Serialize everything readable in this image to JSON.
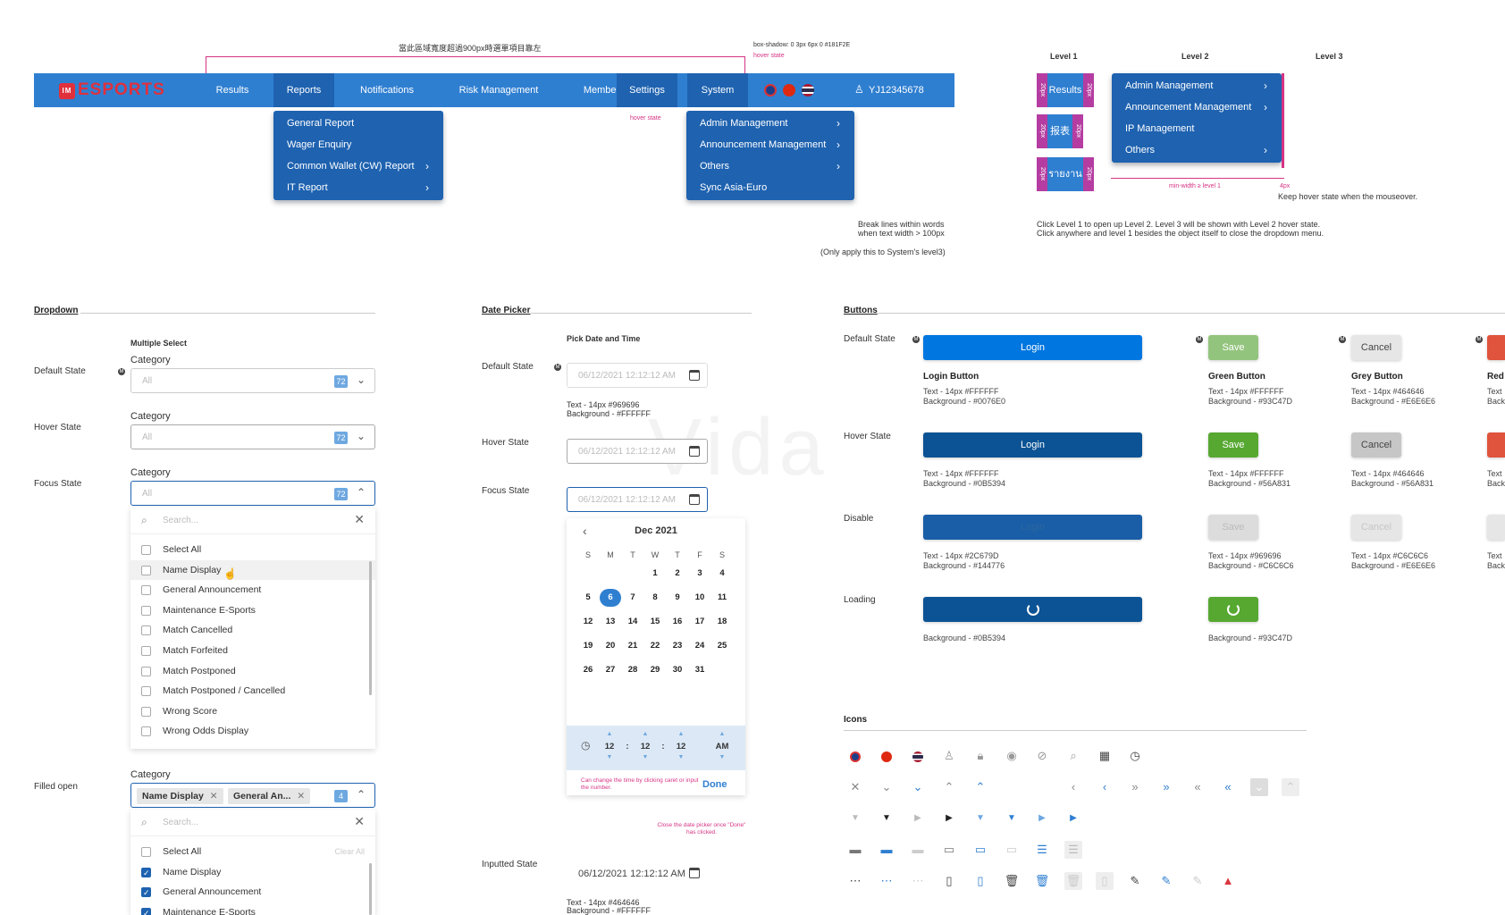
{
  "annotations": {
    "top_chinese": "當此區域寬度超過900px時選單項目靠左",
    "box_shadow": "box-shadow: 0 3px 6px 0 #181F2E",
    "hover_state": "hover state",
    "hover_state2": "hover state",
    "break_lines_1": "Break lines within words",
    "break_lines_2": "when text width > 100px",
    "only_apply": "(Only apply this to System's level3)",
    "click_level_1": "Click Level 1 to open up Level 2. Level 3 will be shown with Level 2 hover state.",
    "click_level_2": "Click anywhere and level 1 besides the object itself to close the dropdown menu.",
    "keep_hover": "Keep hover state when the mouseover.",
    "min_width": "min-width ≥ level 1",
    "px4": "4px",
    "px20": "20px",
    "change_time": "Can change the time by clicking caret or input the number.",
    "close_picker": "Close the date picker once \"Done\" has clicked."
  },
  "nav": {
    "logo": "ESPORTS",
    "logo_badge": "IM",
    "items": [
      "Results",
      "Reports",
      "Notifications",
      "Risk Management",
      "Member",
      "Settings",
      "System"
    ],
    "user": "YJ12345678",
    "reports_menu": [
      {
        "label": "General Report",
        "sub": false
      },
      {
        "label": "Wager Enquiry",
        "sub": false
      },
      {
        "label": "Common Wallet (CW) Report",
        "sub": true
      },
      {
        "label": "IT Report",
        "sub": true
      }
    ],
    "system_menu": [
      {
        "label": "Admin Management",
        "sub": true
      },
      {
        "label": "Announcement Management",
        "sub": true
      },
      {
        "label": "Others",
        "sub": true
      },
      {
        "label": "Sync Asia-Euro",
        "sub": false
      }
    ]
  },
  "levels": {
    "headers": [
      "Level 1",
      "Level 2",
      "Level 3"
    ],
    "level1": [
      "Results",
      "报表",
      "รายงาน"
    ],
    "level2": [
      {
        "label": "Admin Management",
        "sub": true
      },
      {
        "label": "Announcement Management",
        "sub": true
      },
      {
        "label": "IP Management",
        "sub": false
      },
      {
        "label": "Others",
        "sub": true
      }
    ]
  },
  "dropdown": {
    "title": "Dropdown",
    "multiple_select": "Multiple Select",
    "states": [
      "Default State",
      "Hover State",
      "Focus State",
      "Filled open"
    ],
    "category": "Category",
    "placeholder": "All",
    "count": "72",
    "search_placeholder": "Search...",
    "options": [
      "Select All",
      "Name Display",
      "General Announcement",
      "Maintenance E-Sports",
      "Match Cancelled",
      "Match Forfeited",
      "Match Postponed",
      "Match Postponed / Cancelled",
      "Wrong Score",
      "Wrong Odds Display"
    ],
    "filled": {
      "chips": [
        "Name Display",
        "General An..."
      ],
      "count": "4",
      "clear_all": "Clear All",
      "options": [
        {
          "label": "Select All",
          "checked": false
        },
        {
          "label": "Name Display",
          "checked": true
        },
        {
          "label": "General Announcement",
          "checked": true
        },
        {
          "label": "Maintenance E-Sports",
          "checked": true
        }
      ]
    }
  },
  "datepicker": {
    "title": "Date Picker",
    "subtitle": "Pick Date and Time",
    "states": [
      "Default State",
      "Hover State",
      "Focus State",
      "Inputted State"
    ],
    "placeholder": "06/12/2021 12:12:12 AM",
    "value": "06/12/2021 12:12:12 AM",
    "default_desc_1": "Text - 14px #969696",
    "default_desc_2": "Background - #FFFFFF",
    "input_desc_1": "Text - 14px #464646",
    "input_desc_2": "Background - #FFFFFF",
    "month": "Dec 2021",
    "weekdays": [
      "S",
      "M",
      "T",
      "W",
      "T",
      "F",
      "S"
    ],
    "selected_day": 6,
    "time": {
      "h": "12",
      "m": "12",
      "s": "12",
      "ampm": "AM"
    },
    "done": "Done",
    "watermark": "Vida"
  },
  "buttons": {
    "title": "Buttons",
    "states": [
      "Default State",
      "Hover State",
      "Disable",
      "Loading"
    ],
    "login": "Login",
    "save": "Save",
    "cancel": "Cancel",
    "login_title": "Login Button",
    "green_title": "Green Button",
    "grey_title": "Grey Button",
    "red_title": "Red",
    "desc": {
      "login_default": [
        "Text - 14px #FFFFFF",
        "Background - #0076E0"
      ],
      "login_hover": [
        "Text - 14px #FFFFFF",
        "Background - #0B5394"
      ],
      "login_disable": [
        "Text - 14px #2C679D",
        "Background - #144776"
      ],
      "login_loading": [
        "Background - #0B5394"
      ],
      "green_default": [
        "Text - 14px #FFFFFF",
        "Background - #93C47D"
      ],
      "green_hover": [
        "Text - 14px #FFFFFF",
        "Background - #56A831"
      ],
      "green_disable": [
        "Text - 14px #969696",
        "Background - #C6C6C6"
      ],
      "green_loading": [
        "Background - #93C47D"
      ],
      "grey_default": [
        "Text - 14px #464646",
        "Background - #E6E6E6"
      ],
      "grey_hover": [
        "Text - 14px #464646",
        "Background - #56A831"
      ],
      "grey_disable": [
        "Text - 14px #C6C6C6",
        "Background - #E6E6E6"
      ],
      "red_text": "Text",
      "red_back": "Back"
    },
    "colors": {
      "login": "#0076E0",
      "login_hover": "#0B5394",
      "login_disable": "#144776",
      "green": "#93C47D",
      "green_hover": "#56A831",
      "grey": "#E6E6E6",
      "red": "#E0533C"
    }
  },
  "icons": {
    "title": "Icons"
  }
}
